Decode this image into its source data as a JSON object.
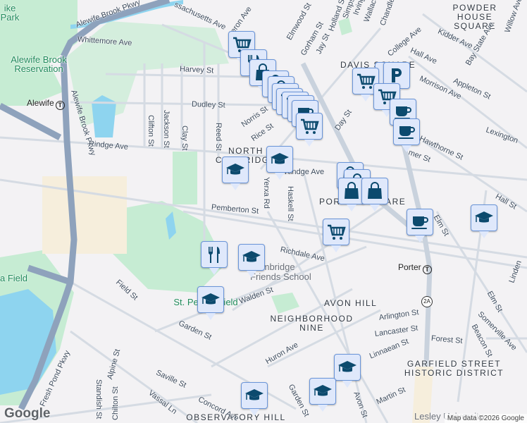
{
  "areas": {
    "powder_house": "POWDER HOUSE SQUARE",
    "davis": "DAVIS SQUARE",
    "north_cambridge": "NORTH CAMBRIDGE",
    "porter": "PORTER SQUARE",
    "avon_hill": "AVON HILL",
    "neighborhood_nine": "NEIGHBORHOOD NINE",
    "garfield": "GARFIELD STREET HISTORIC DISTRICT",
    "observatory": "OBSERVATORY HILL"
  },
  "parks": {
    "reservation": "Alewife Brook Reservation",
    "park": "ike Park",
    "st_peters": "St. Peter's Field",
    "field": "a Field"
  },
  "poi": {
    "friends_school": "Cambridge Friends School",
    "lesley": "Lesley University"
  },
  "stations": {
    "alewife": "Alewife",
    "porter": "Porter",
    "transit_symbol": "T"
  },
  "route_shield": "2A",
  "streets": [
    "Alewife Brook Pkwy",
    "ssachusetts Ave",
    "Whittemore Ave",
    "Harvey St",
    "Dudley St",
    "Alewife Brook Pkwy",
    "Clifton St",
    "Jackson St",
    "Clay St",
    "Reed St",
    "Rindge Ave",
    "Norris St",
    "Rice St",
    "Yerxa Rd",
    "Haskell St",
    "Pemberton St",
    "Richdale Ave",
    "Rindge Ave",
    "College Ave",
    "Kidder Ave",
    "Hall Ave",
    "Bay State Ave",
    "Morrison Ave",
    "Appleton St",
    "Hawthorne St",
    "Lexington",
    "mer St",
    "Elm St",
    "Hall St",
    "Day St",
    "Elmwood St",
    "Gorham St",
    "Jay St",
    "Holland St",
    "Simpson",
    "Irving",
    "Wallace",
    "Chandler St",
    "eron Ave",
    "Arlington St",
    "Lancaster St",
    "Forest St",
    "Linnaean St",
    "Martin St",
    "Avon St",
    "Huron Ave",
    "Garden St",
    "Garden St",
    "Walden St",
    "Field St",
    "Alpine St",
    "Saville St",
    "Vassal Ln",
    "Concord Ave",
    "Standish St",
    "Chilton St",
    "Fresh Pond Pkwy",
    "Somerville Ave",
    "Beacon St",
    "Linden",
    "Elm St",
    "Willow Ave"
  ],
  "markers": [
    "shopping-cart",
    "restaurant",
    "shopping-bag",
    "shopping-bag",
    "shopping-bag",
    "school",
    "cart",
    "cart",
    "cart",
    "coffee",
    "parking",
    "parking",
    "shopping-cart",
    "cart",
    "coffee",
    "coffee",
    "shopping-cart",
    "school",
    "school",
    "shopping-bag",
    "shopping-bag",
    "shopping-bag",
    "shopping-bag",
    "coffee",
    "school",
    "shopping-cart",
    "restaurant",
    "school",
    "school",
    "school",
    "school",
    "school"
  ],
  "colors": {
    "marker_bg": "#dfe8fb",
    "marker_border": "#6a95d9",
    "icon": "#0c4a6e",
    "park": "#c6ecd3",
    "water": "#8ed4ef",
    "highway": "#8ea2bc"
  },
  "attribution": "Map data ©2026 Google",
  "logo": "Google"
}
